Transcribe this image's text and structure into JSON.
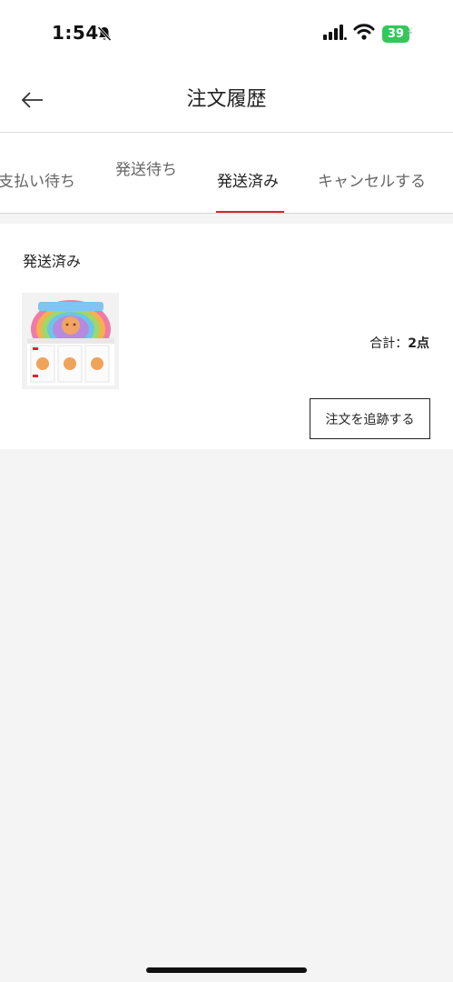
{
  "status_bar": {
    "time": "1:54",
    "battery": "39",
    "icons": [
      "bell-slash-icon",
      "cellular-signal-icon",
      "wifi-icon",
      "battery-icon"
    ]
  },
  "header": {
    "title": "注文履歴",
    "back_icon": "arrow-left-icon"
  },
  "tabs": [
    {
      "label": "支払い待ち",
      "active": false
    },
    {
      "label": "発送待ち",
      "active": false
    },
    {
      "label": "発送済み",
      "active": true
    },
    {
      "label": "キャンセルする",
      "active": false
    }
  ],
  "order": {
    "status": "発送済み",
    "total_label": "合計：",
    "total_count": "2点",
    "track_button_label": "注文を追跡する",
    "thumbnail": "product-box-image"
  },
  "colors": {
    "accent": "#d9232e",
    "battery": "#34c759",
    "background": "#f4f4f4"
  }
}
